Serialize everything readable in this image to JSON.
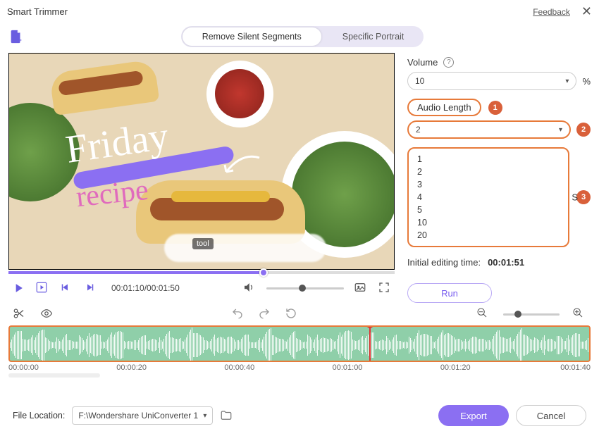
{
  "window": {
    "title": "Smart Trimmer",
    "feedback": "Feedback"
  },
  "tabs": {
    "remove": "Remove Silent Segments",
    "portrait": "Specific Portrait"
  },
  "video": {
    "tooltip": "tool",
    "script_main": "Friday",
    "script_sub": "recipe"
  },
  "player": {
    "time": "00:01:10/00:01:50"
  },
  "side": {
    "volume_label": "Volume",
    "volume_value": "10",
    "volume_unit": "%",
    "audio_length_label": "Audio Length",
    "audio_length_value": "2",
    "audio_length_unit": "S",
    "options": {
      "o1": "1",
      "o2": "2",
      "o3": "3",
      "o4": "4",
      "o5": "5",
      "o10": "10",
      "o20": "20"
    },
    "initial_label": "Initial editing time:",
    "initial_value": "00:01:51",
    "run": "Run"
  },
  "badges": {
    "b1": "1",
    "b2": "2",
    "b3": "3"
  },
  "axis": {
    "t0": "00:00:00",
    "t1": "00:00:20",
    "t2": "00:00:40",
    "t3": "00:01:00",
    "t4": "00:01:20",
    "t5": "00:01:40"
  },
  "footer": {
    "file_loc_label": "File Location:",
    "file_loc_value": "F:\\Wondershare UniConverter 1",
    "export": "Export",
    "cancel": "Cancel"
  }
}
